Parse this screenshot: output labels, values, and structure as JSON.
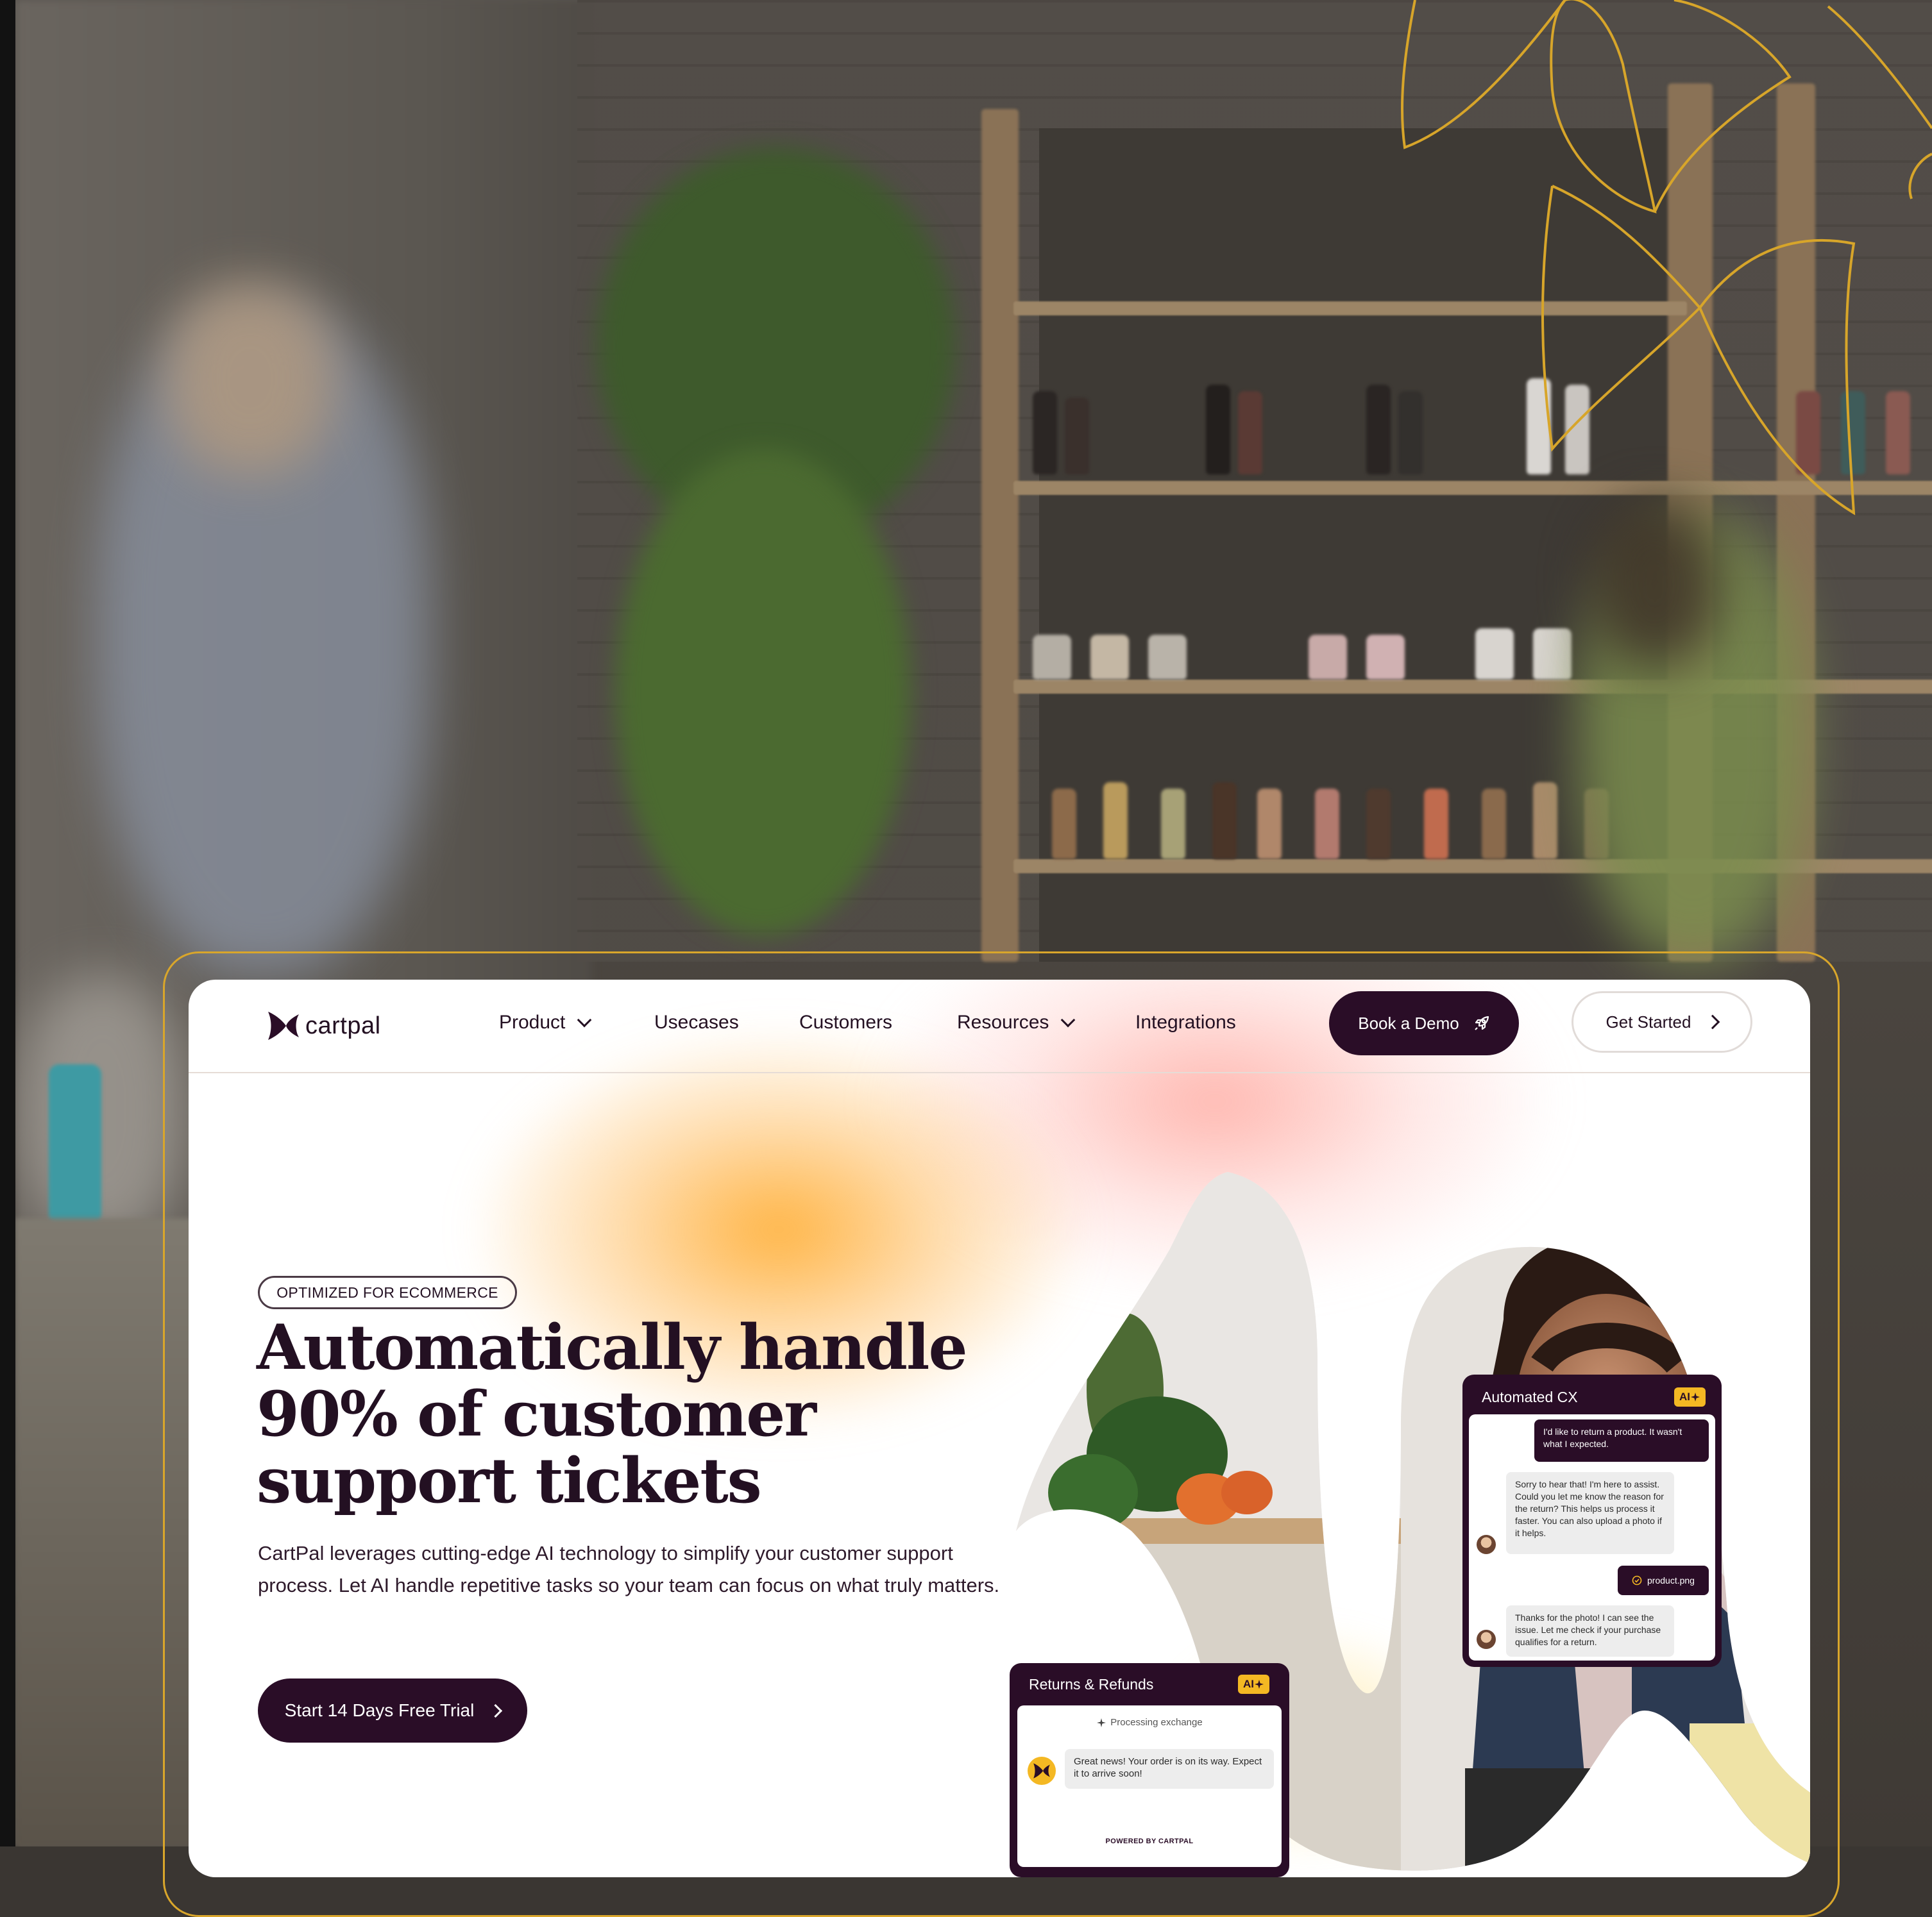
{
  "brand": {
    "name": "cartpal",
    "primary": "#2a0d27",
    "accent": "#f4b823",
    "frame": "#d9a62b"
  },
  "nav": {
    "items": [
      {
        "label": "Product",
        "has_dropdown": true
      },
      {
        "label": "Usecases",
        "has_dropdown": false
      },
      {
        "label": "Customers",
        "has_dropdown": false
      },
      {
        "label": "Resources",
        "has_dropdown": true
      },
      {
        "label": "Integrations",
        "has_dropdown": false
      }
    ],
    "book_demo": "Book a Demo",
    "get_started": "Get Started"
  },
  "hero": {
    "badge": "OPTIMIZED FOR ECOMMERCE",
    "headline_lines": [
      "Automatically handle",
      "90% of customer",
      "support tickets"
    ],
    "subtext": "CartPal leverages cutting-edge AI technology to simplify your customer support process. Let AI handle repetitive tasks so your team can focus on what truly matters.",
    "cta": "Start 14 Days Free Trial"
  },
  "widgets": {
    "automated_cx": {
      "title": "Automated CX",
      "ai_badge": "AI",
      "messages": [
        "I'd like to return a product. It wasn't what I expected.",
        "Sorry to hear that! I'm here to assist. Could you let me know the reason for the return? This helps us process it faster. You can also upload a photo if it helps.",
        "product.png",
        "Thanks for the photo! I can see the issue. Let me check if your purchase qualifies for a return."
      ]
    },
    "returns": {
      "title": "Returns & Refunds",
      "ai_badge": "AI",
      "status": "Processing exchange",
      "message": "Great news! Your order is on its way. Expect it to arrive soon!",
      "footer": "POWERED BY CARTPAL"
    }
  },
  "icons": [
    "cartpal-logo-icon",
    "chevron-down-icon",
    "rocket-icon",
    "chevron-right-icon",
    "sparkle-icon",
    "check-circle-icon"
  ]
}
